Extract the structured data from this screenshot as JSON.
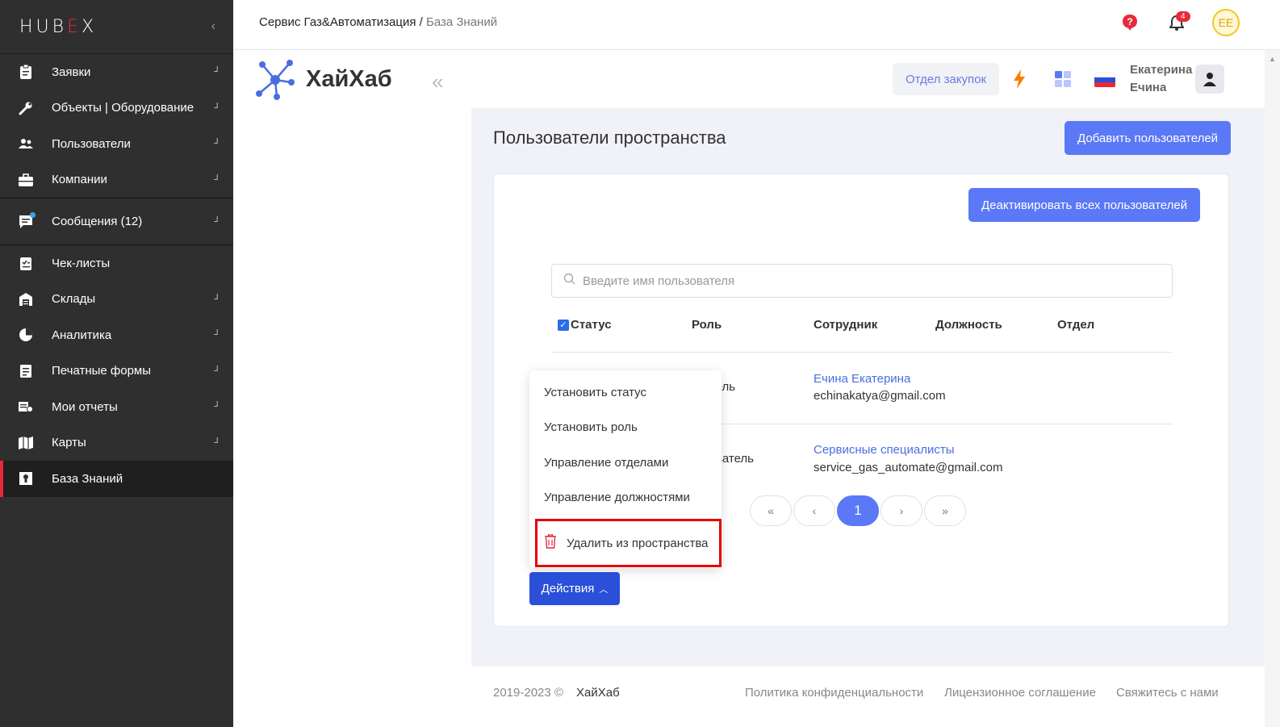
{
  "sidebar": {
    "brand_left": "HUB",
    "brand_mid": "E",
    "brand_right": "X",
    "collapse_glyph": "‹",
    "items": [
      {
        "label": "Заявки",
        "icon": "clipboard-icon"
      },
      {
        "label": "Объекты | Оборудование",
        "icon": "wrench-icon"
      },
      {
        "label": "Пользователи",
        "icon": "users-icon"
      },
      {
        "label": "Компании",
        "icon": "briefcase-icon"
      },
      {
        "label": "Сообщения (12)",
        "icon": "message-icon"
      },
      {
        "label": "Чек-листы",
        "icon": "checklist-icon"
      },
      {
        "label": "Склады",
        "icon": "warehouse-icon"
      },
      {
        "label": "Аналитика",
        "icon": "pie-chart-icon"
      },
      {
        "label": "Печатные формы",
        "icon": "print-form-icon"
      },
      {
        "label": "Мои отчеты",
        "icon": "reports-icon"
      },
      {
        "label": "Карты",
        "icon": "map-icon"
      },
      {
        "label": "База Знаний",
        "icon": "knowledge-icon"
      }
    ]
  },
  "topbar": {
    "breadcrumb_main": "Сервис Газ&Автоматизация",
    "breadcrumb_sep": " / ",
    "breadcrumb_current": "База Знаний",
    "notifications_count": "4",
    "avatar_initials": "ЕЕ"
  },
  "workspace": {
    "logo_text": "ХайХаб",
    "collapse_glyph": "«",
    "department_button": "Отдел закупок",
    "user_first": "Екатерина",
    "user_last": "Ечина"
  },
  "page": {
    "title": "Пользователи пространства",
    "add_button": "Добавить пользователей",
    "deactivate_button": "Деактивировать всех пользователей",
    "search_placeholder": "Введите имя пользователя"
  },
  "table": {
    "headers": [
      "Статус",
      "Роль",
      "Сотрудник",
      "Должность",
      "Отдел"
    ],
    "rows": [
      {
        "role": "атель",
        "name": "Ечина Екатерина",
        "email": "echinakatya@gmail.com"
      },
      {
        "role": "зователь",
        "name": "Сервисные специалисты",
        "email": "service_gas_automate@gmail.com"
      }
    ]
  },
  "pagination": {
    "first": "«",
    "prev": "‹",
    "current": "1",
    "next": "›",
    "last": "»"
  },
  "actions_menu": {
    "items": [
      "Установить статус",
      "Установить роль",
      "Управление отделами",
      "Управление должностями"
    ],
    "delete": "Удалить из пространства",
    "button": "Действия"
  },
  "footer": {
    "copyright": "2019-2023 ©",
    "brand": "ХайХаб",
    "privacy": "Политика конфиденциальности",
    "license": "Лицензионное соглашение",
    "contact": "Свяжитесь с нами"
  },
  "colors": {
    "accent": "#5b78f6",
    "sidebar_bg": "#2f2f2f",
    "active_marker": "#e8293a",
    "highlight_box": "#e50000"
  }
}
